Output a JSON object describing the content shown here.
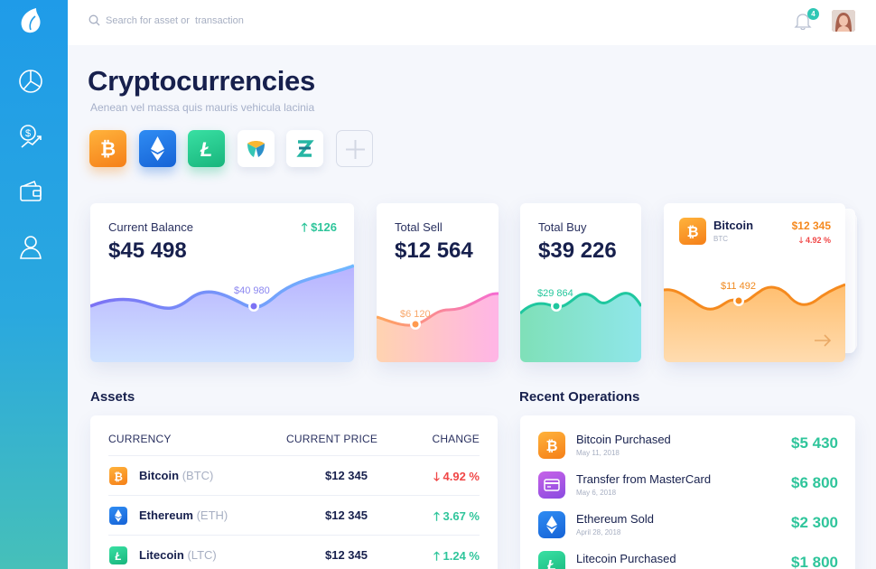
{
  "search": {
    "placeholder": "Search for asset or  transaction"
  },
  "notifications": {
    "count": "4"
  },
  "sidebar": {
    "items": [
      {
        "icon": "pie-chart-icon"
      },
      {
        "icon": "dollar-growth-icon"
      },
      {
        "icon": "wallet-icon"
      },
      {
        "icon": "user-icon"
      }
    ]
  },
  "header": {
    "title": "Cryptocurrencies",
    "subtitle": "Aenean vel massa quis mauris vehicula lacinia"
  },
  "coins": [
    {
      "icon": "bitcoin-icon"
    },
    {
      "icon": "ethereum-icon"
    },
    {
      "icon": "litecoin-icon"
    },
    {
      "icon": "nem-icon"
    },
    {
      "icon": "zencash-icon"
    },
    {
      "icon": "add-icon"
    }
  ],
  "cards": {
    "balance": {
      "label": "Current Balance",
      "value": "$45 498",
      "change": "$126",
      "point": "$40 980"
    },
    "sell": {
      "label": "Total Sell",
      "value": "$12 564",
      "point": "$6 120"
    },
    "buy": {
      "label": "Total Buy",
      "value": "$39 226",
      "point": "$29 864"
    },
    "bitcoin": {
      "name": "Bitcoin",
      "ticker": "BTC",
      "price": "$12 345",
      "change": "4.92 %",
      "point": "$11 492"
    }
  },
  "assets": {
    "title": "Assets",
    "headers": {
      "currency": "CURRENCY",
      "price": "CURRENT PRICE",
      "change": "CHANGE"
    },
    "rows": [
      {
        "name": "Bitcoin",
        "ticker": "(BTC)",
        "price": "$12 345",
        "change": "4.92 %",
        "direction": "down"
      },
      {
        "name": "Ethereum",
        "ticker": "(ETH)",
        "price": "$12 345",
        "change": "3.67 %",
        "direction": "up"
      },
      {
        "name": "Litecoin",
        "ticker": "(LTC)",
        "price": "$12 345",
        "change": "1.24 %",
        "direction": "up"
      }
    ]
  },
  "operations": {
    "title": "Recent Operations",
    "rows": [
      {
        "title": "Bitcoin Purchased",
        "date": "May 11, 2018",
        "amount": "$5 430"
      },
      {
        "title": "Transfer from MasterCard",
        "date": "May 6, 2018",
        "amount": "$6 800"
      },
      {
        "title": "Ethereum Sold",
        "date": "April 28, 2018",
        "amount": "$2 300"
      },
      {
        "title": "Litecoin Purchased",
        "date": "",
        "amount": "$1 800"
      }
    ]
  },
  "colors": {
    "accent": "#1f9be8",
    "positive": "#2fc59b",
    "negative": "#f04646",
    "bitcoin": "#f5891f"
  }
}
